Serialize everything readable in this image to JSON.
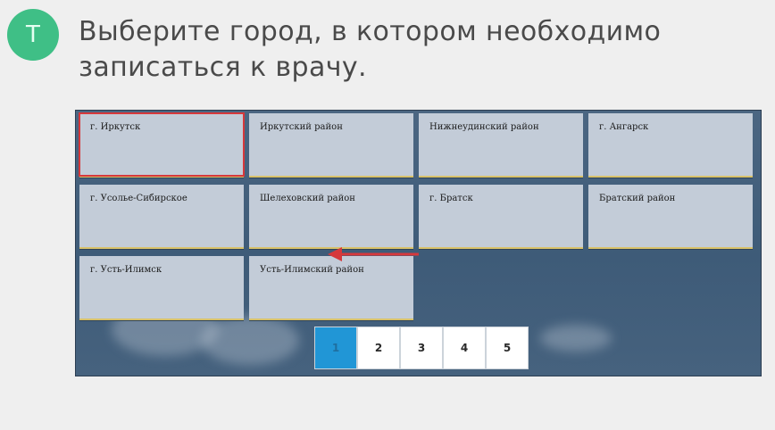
{
  "step": {
    "letter": "Т"
  },
  "header": {
    "title": "Выберите город, в котором необходимо записаться к врачу."
  },
  "districts": [
    {
      "label": "г. Иркутск",
      "selected": true
    },
    {
      "label": "Иркутский район",
      "selected": false
    },
    {
      "label": "Нижнеудинский район",
      "selected": false
    },
    {
      "label": "г. Ангарск",
      "selected": false
    },
    {
      "label": "г. Усолье-Сибирское",
      "selected": false
    },
    {
      "label": "Шелеховский район",
      "selected": false
    },
    {
      "label": "г. Братск",
      "selected": false
    },
    {
      "label": "Братский район",
      "selected": false
    },
    {
      "label": "г. Усть-Илимск",
      "selected": false
    },
    {
      "label": "Усть-Илимский район",
      "selected": false
    }
  ],
  "pagination": {
    "pages": [
      "1",
      "2",
      "3",
      "4",
      "5"
    ],
    "current": "1"
  },
  "colors": {
    "badge": "#3fbf86",
    "highlight": "#d6383b",
    "active_page": "#2196d6"
  }
}
